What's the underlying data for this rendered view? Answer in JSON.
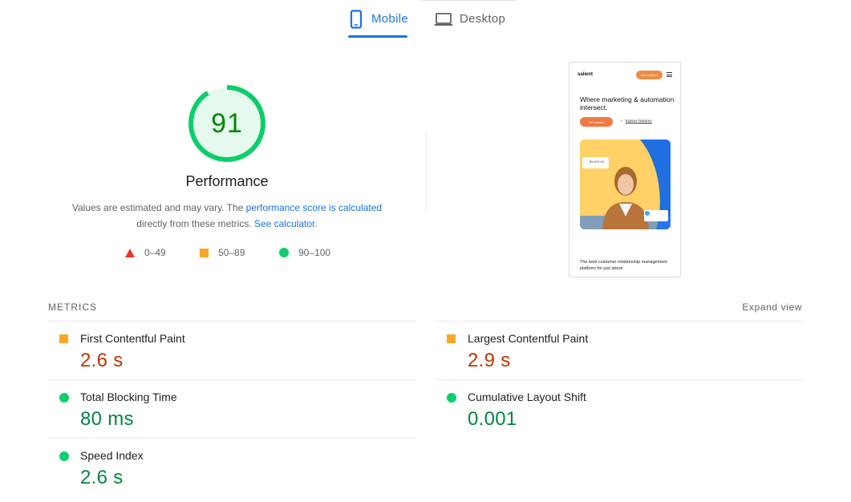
{
  "tabs": [
    {
      "label": "Mobile",
      "icon": "phone-icon",
      "active": true
    },
    {
      "label": "Desktop",
      "icon": "laptop-icon",
      "active": false
    }
  ],
  "performance": {
    "score": "91",
    "score_fraction": 0.91,
    "title": "Performance",
    "desc_prefix": "Values are estimated and may vary. The ",
    "desc_link1": "performance score is calculated",
    "desc_middle": " directly from these metrics. ",
    "desc_link2": "See calculator."
  },
  "legend": {
    "fail": "0–49",
    "average": "50–89",
    "pass": "90–100"
  },
  "screenshot": {
    "logo": "salient",
    "cta_top": "Get a demo",
    "headline": "Where marketing & automation intersect.",
    "primary_button": "Get started",
    "secondary_button": "Explore features",
    "card_amount": "$3,670.00",
    "caption": "The best customer relationship management platform for just about"
  },
  "metrics_section": {
    "label": "METRICS",
    "expand": "Expand view"
  },
  "metrics": {
    "fcp": {
      "name": "First Contentful Paint",
      "value": "2.6 s",
      "status": "average"
    },
    "lcp": {
      "name": "Largest Contentful Paint",
      "value": "2.9 s",
      "status": "average"
    },
    "tbt": {
      "name": "Total Blocking Time",
      "value": "80 ms",
      "status": "pass"
    },
    "cls": {
      "name": "Cumulative Layout Shift",
      "value": "0.001",
      "status": "pass"
    },
    "si": {
      "name": "Speed Index",
      "value": "2.6 s",
      "status": "pass"
    }
  },
  "colors": {
    "accent": "#1a73e8",
    "pass": "#0cce6b",
    "average": "#f9a825",
    "fail": "#e8362b",
    "pass_text": "#018642",
    "average_text": "#c33300"
  }
}
